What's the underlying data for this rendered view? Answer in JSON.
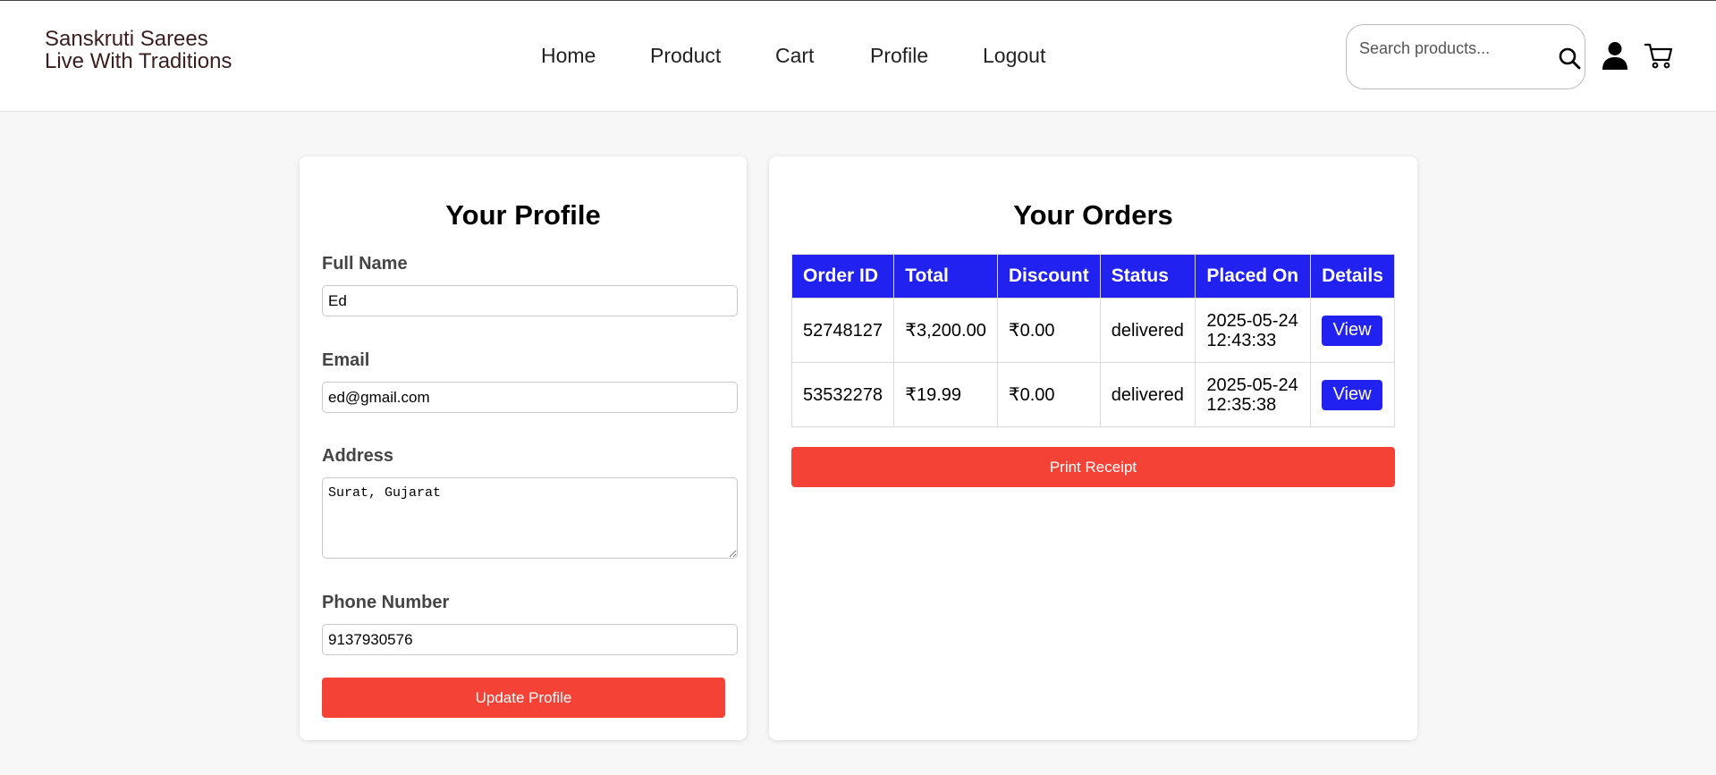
{
  "header": {
    "brand_line1": "Sanskruti Sarees",
    "brand_line2": "Live With Traditions",
    "nav": [
      "Home",
      "Product",
      "Cart",
      "Profile",
      "Logout"
    ],
    "search_placeholder": "Search products...",
    "icons": [
      "search-icon",
      "user-icon",
      "cart-icon"
    ]
  },
  "profile": {
    "title": "Your Profile",
    "full_name_label": "Full Name",
    "full_name_value": "Ed",
    "email_label": "Email",
    "email_value": "ed@gmail.com",
    "address_label": "Address",
    "address_value": "Surat, Gujarat",
    "phone_label": "Phone Number",
    "phone_value": "9137930576",
    "update_button": "Update Profile"
  },
  "orders": {
    "title": "Your Orders",
    "columns": [
      "Order ID",
      "Total",
      "Discount",
      "Status",
      "Placed On",
      "Details"
    ],
    "rows": [
      {
        "order_id": "52748127",
        "total": "₹3,200.00",
        "discount": "₹0.00",
        "status": "delivered",
        "placed_date": "2025-05-24",
        "placed_time": "12:43:33",
        "details": "View"
      },
      {
        "order_id": "53532278",
        "total": "₹19.99",
        "discount": "₹0.00",
        "status": "delivered",
        "placed_date": "2025-05-24",
        "placed_time": "12:35:38",
        "details": "View"
      }
    ],
    "print_button": "Print Receipt"
  },
  "colors": {
    "accent_blue": "#2121f0",
    "accent_red": "#f44336",
    "brand_text": "#3b1f1f",
    "page_background": "#f7f7f7"
  }
}
